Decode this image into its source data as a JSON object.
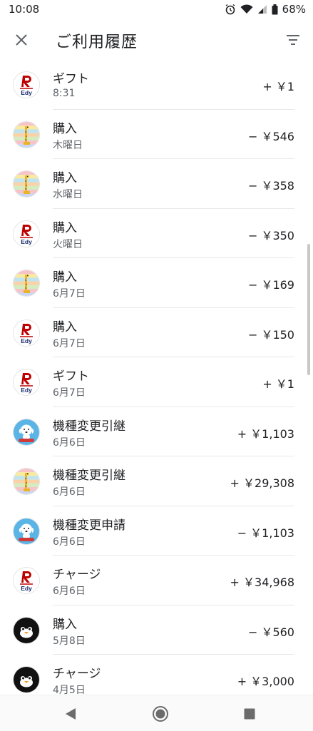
{
  "status_bar": {
    "time": "10:08",
    "battery": "68%"
  },
  "app_bar": {
    "title": "ご利用履歴"
  },
  "icons": {
    "edy": {
      "name": "rakuten-edy-icon",
      "red": "#bf0000",
      "navy": "#1a2a6c"
    },
    "giraffe": {
      "name": "giraffe-card-icon"
    },
    "waon": {
      "name": "waon-icon",
      "bg": "#5ab4e5"
    },
    "suica": {
      "name": "suica-penguin-icon"
    }
  },
  "transactions": [
    {
      "icon": "edy",
      "label": "ギフト",
      "date": "8:31",
      "amount": "+ ￥1"
    },
    {
      "icon": "giraffe",
      "label": "購入",
      "date": "木曜日",
      "amount": "− ￥546"
    },
    {
      "icon": "giraffe",
      "label": "購入",
      "date": "水曜日",
      "amount": "− ￥358"
    },
    {
      "icon": "edy",
      "label": "購入",
      "date": "火曜日",
      "amount": "− ￥350"
    },
    {
      "icon": "giraffe",
      "label": "購入",
      "date": "6月7日",
      "amount": "− ￥169"
    },
    {
      "icon": "edy",
      "label": "購入",
      "date": "6月7日",
      "amount": "− ￥150"
    },
    {
      "icon": "edy",
      "label": "ギフト",
      "date": "6月7日",
      "amount": "+ ￥1"
    },
    {
      "icon": "waon",
      "label": "機種変更引継",
      "date": "6月6日",
      "amount": "+ ￥1,103"
    },
    {
      "icon": "giraffe",
      "label": "機種変更引継",
      "date": "6月6日",
      "amount": "+ ￥29,308"
    },
    {
      "icon": "waon",
      "label": "機種変更申請",
      "date": "6月6日",
      "amount": "− ￥1,103"
    },
    {
      "icon": "edy",
      "label": "チャージ",
      "date": "6月6日",
      "amount": "+ ￥34,968"
    },
    {
      "icon": "suica",
      "label": "購入",
      "date": "5月8日",
      "amount": "− ￥560"
    },
    {
      "icon": "suica",
      "label": "チャージ",
      "date": "4月5日",
      "amount": "+ ￥3,000"
    }
  ]
}
